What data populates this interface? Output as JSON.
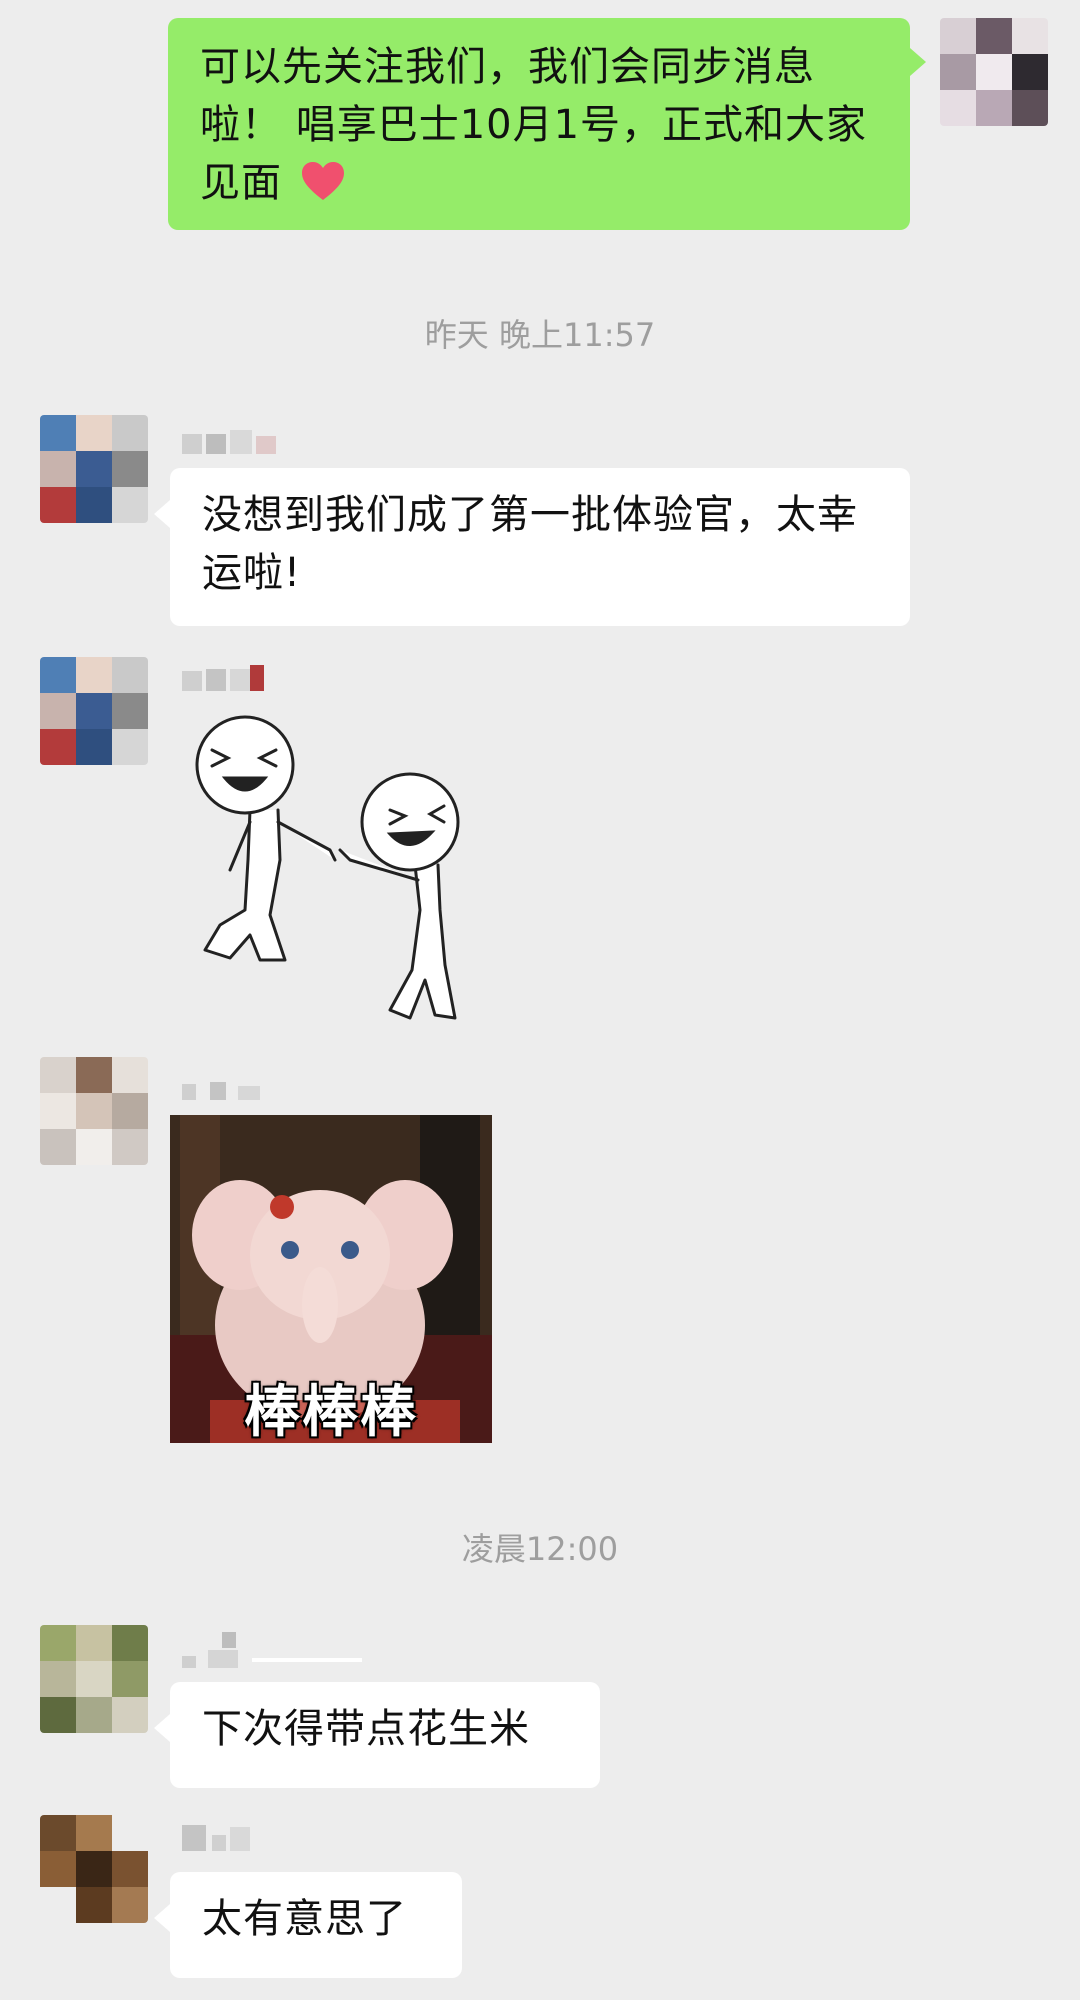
{
  "messages": {
    "m1": {
      "text": "可以先关注我们，我们会同步消息啦！ 唱享巴士10月1号，正式和大家见面"
    },
    "m2": {
      "text": "没想到我们成了第一批体验官，太幸运啦!"
    },
    "m5": {
      "text": "下次得带点花生米"
    },
    "m6": {
      "text": "太有意思了"
    }
  },
  "timestamps": {
    "t1": "昨天 晚上11:57",
    "t2": "凌晨12:00"
  },
  "stickers": {
    "gif_caption": "棒棒棒"
  },
  "icons": {
    "heart": "heart-emoji",
    "stick_figures": "dancing-stick-figures"
  },
  "colors": {
    "background": "#ededed",
    "self_bubble": "#95ec69",
    "other_bubble": "#ffffff",
    "timestamp_text": "#9e9e9e"
  }
}
